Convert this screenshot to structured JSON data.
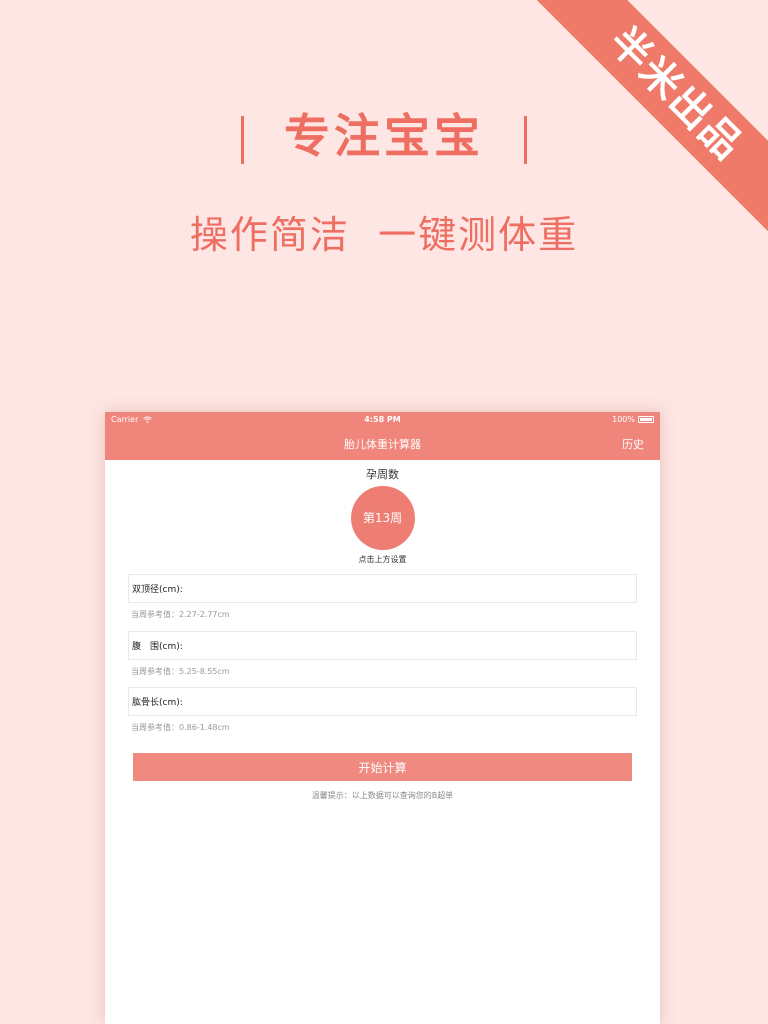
{
  "promo": {
    "ribbon": "半米出品",
    "headline": "专注宝宝",
    "subline": "操作简洁  一键测体重"
  },
  "status": {
    "carrier": "Carrier",
    "time": "4:58 PM",
    "battery": "100%"
  },
  "nav": {
    "title": "胎儿体重计算器",
    "history": "历史"
  },
  "weeks": {
    "label": "孕周数",
    "value": "第13周",
    "hint": "点击上方设置"
  },
  "fields": [
    {
      "label": "双顶径(cm):",
      "value": "",
      "ref": "当周参考值：2.27-2.77cm"
    },
    {
      "label": "腹　围(cm):",
      "value": "",
      "ref": "当周参考值：5.25-8.55cm"
    },
    {
      "label": "肱骨长(cm):",
      "value": "",
      "ref": "当周参考值：0.86-1.48cm"
    }
  ],
  "action": {
    "calculate": "开始计算",
    "tip": "温馨提示：以上数据可以查询您的B超单"
  },
  "colors": {
    "background": "#fde6e4",
    "accent": "#f0857b",
    "ribbon": "#f07a6a",
    "headline": "#ee6e62"
  }
}
